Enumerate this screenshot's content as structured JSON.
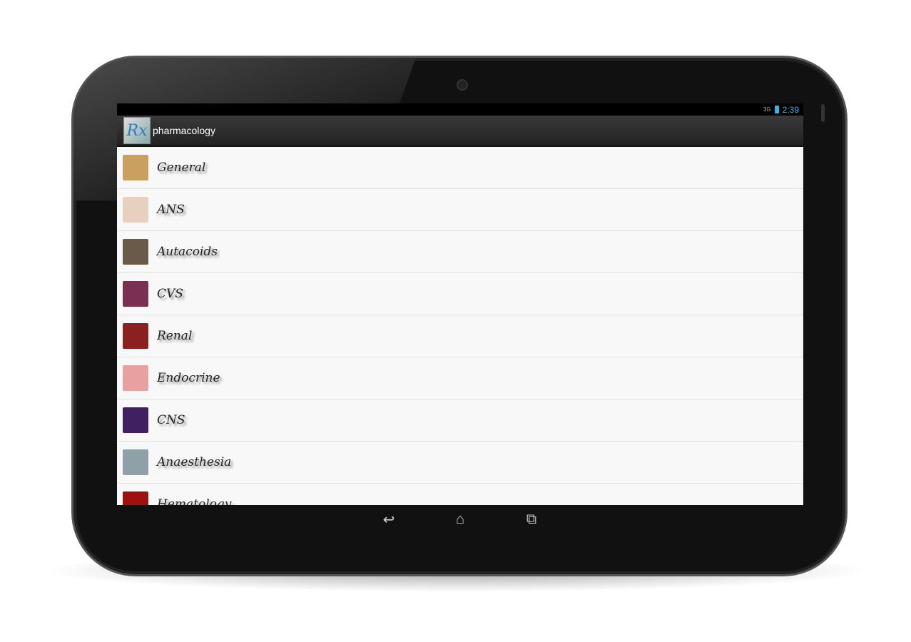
{
  "status": {
    "network": "3G",
    "time": "2:39",
    "battery_icon": "battery-charging-icon"
  },
  "actionbar": {
    "title": "pharmacology",
    "logo": "Rx"
  },
  "items": [
    {
      "label": "General",
      "color": "#c9a060"
    },
    {
      "label": "ANS",
      "color": "#e8d0c0"
    },
    {
      "label": "Autacoids",
      "color": "#6a5a4a"
    },
    {
      "label": "CVS",
      "color": "#7a3050"
    },
    {
      "label": "Renal",
      "color": "#8a2020"
    },
    {
      "label": "Endocrine",
      "color": "#e8a0a0"
    },
    {
      "label": "CNS",
      "color": "#402060"
    },
    {
      "label": "Anaesthesia",
      "color": "#90a0a8"
    },
    {
      "label": "Hematology",
      "color": "#a01010"
    }
  ],
  "nav": {
    "back": "back-icon",
    "home": "home-icon",
    "recents": "recents-icon"
  }
}
